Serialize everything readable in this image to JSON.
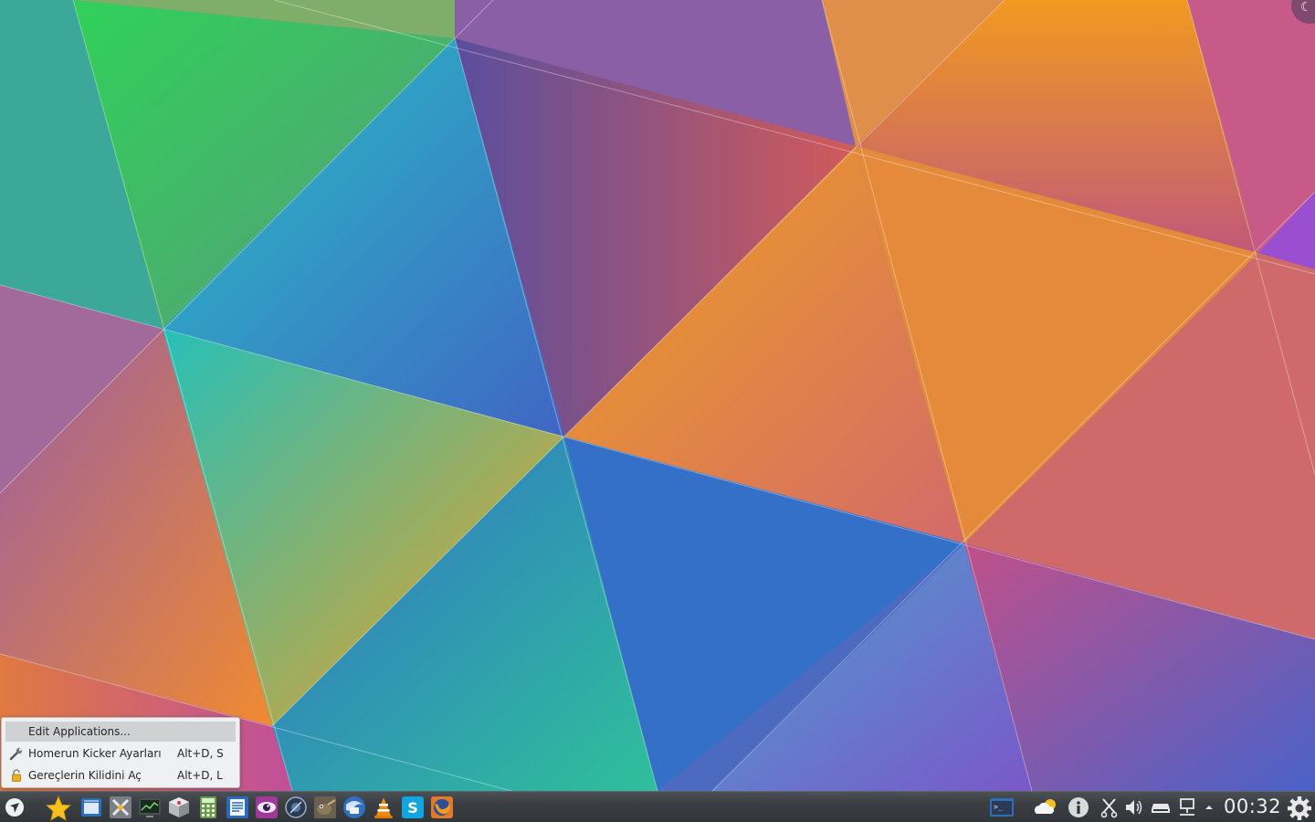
{
  "context_menu": {
    "items": [
      {
        "label": "Edit Applications...",
        "shortcut": ""
      },
      {
        "label": "Homerun Kicker Ayarları",
        "shortcut": "Alt+D, S"
      },
      {
        "label": "Gereçlerin Kilidini Aç",
        "shortcut": "Alt+D, L"
      }
    ]
  },
  "taskbar": {
    "launcher_icon": "kde-launcher-icon",
    "pinned_apps": [
      "favorites-star-icon",
      "dolphin-file-manager-icon",
      "system-settings-icon",
      "system-monitor-icon",
      "package-manager-icon",
      "calculator-icon",
      "text-editor-icon",
      "eye-viewer-icon",
      "media-player-icon",
      "gimp-icon",
      "thunderbird-icon",
      "vlc-icon",
      "skype-icon",
      "firefox-icon"
    ],
    "tray_icons": [
      "terminal-task-icon",
      "weather-icon",
      "info-icon",
      "clipboard-scissors-icon",
      "volume-icon",
      "storage-device-icon",
      "network-icon",
      "tray-expand-arrow-icon"
    ],
    "clock": "00:32"
  },
  "colors": {
    "panel": "#31363b",
    "menu_bg": "#eff0f1",
    "menu_highlight": "#d0d1d3"
  }
}
